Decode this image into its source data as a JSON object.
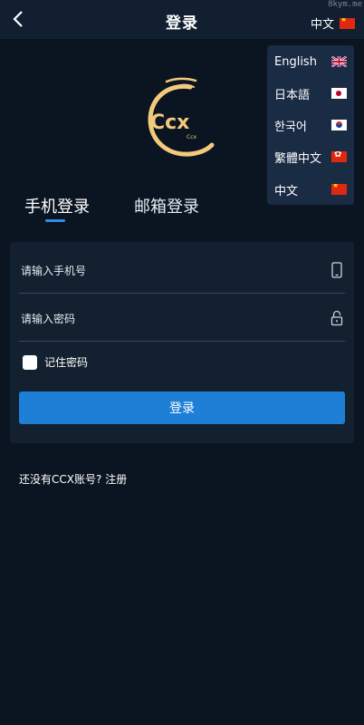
{
  "header": {
    "title": "登录",
    "current_language": "中文",
    "current_language_flag": "flag-cn-icon"
  },
  "watermark": "8kym.me",
  "language_menu": [
    {
      "label": "English",
      "flag": "flag-uk-icon"
    },
    {
      "label": "日本語",
      "flag": "flag-jp-icon"
    },
    {
      "label": "한국어",
      "flag": "flag-kr-icon"
    },
    {
      "label": "繁體中文",
      "flag": "flag-hk-icon"
    },
    {
      "label": "中文",
      "flag": "flag-cn-icon"
    }
  ],
  "logo": {
    "text": "Ccx",
    "subtext": "Ccx"
  },
  "tabs": [
    {
      "label": "手机登录",
      "active": true
    },
    {
      "label": "邮箱登录",
      "active": false
    }
  ],
  "form": {
    "phone_placeholder": "请输入手机号",
    "phone_value": "",
    "password_placeholder": "请输入密码",
    "password_value": "",
    "remember_label": "记住密码",
    "remember_checked": false,
    "submit_label": "登录"
  },
  "footer": {
    "register_prompt": "还没有CCX账号?",
    "register_link": "注册"
  },
  "colors": {
    "background": "#0b1521",
    "card": "#12202f",
    "accent": "#1e7fd6",
    "logo_gold": "#f2c97d",
    "menu_bg": "#1a2b44"
  }
}
